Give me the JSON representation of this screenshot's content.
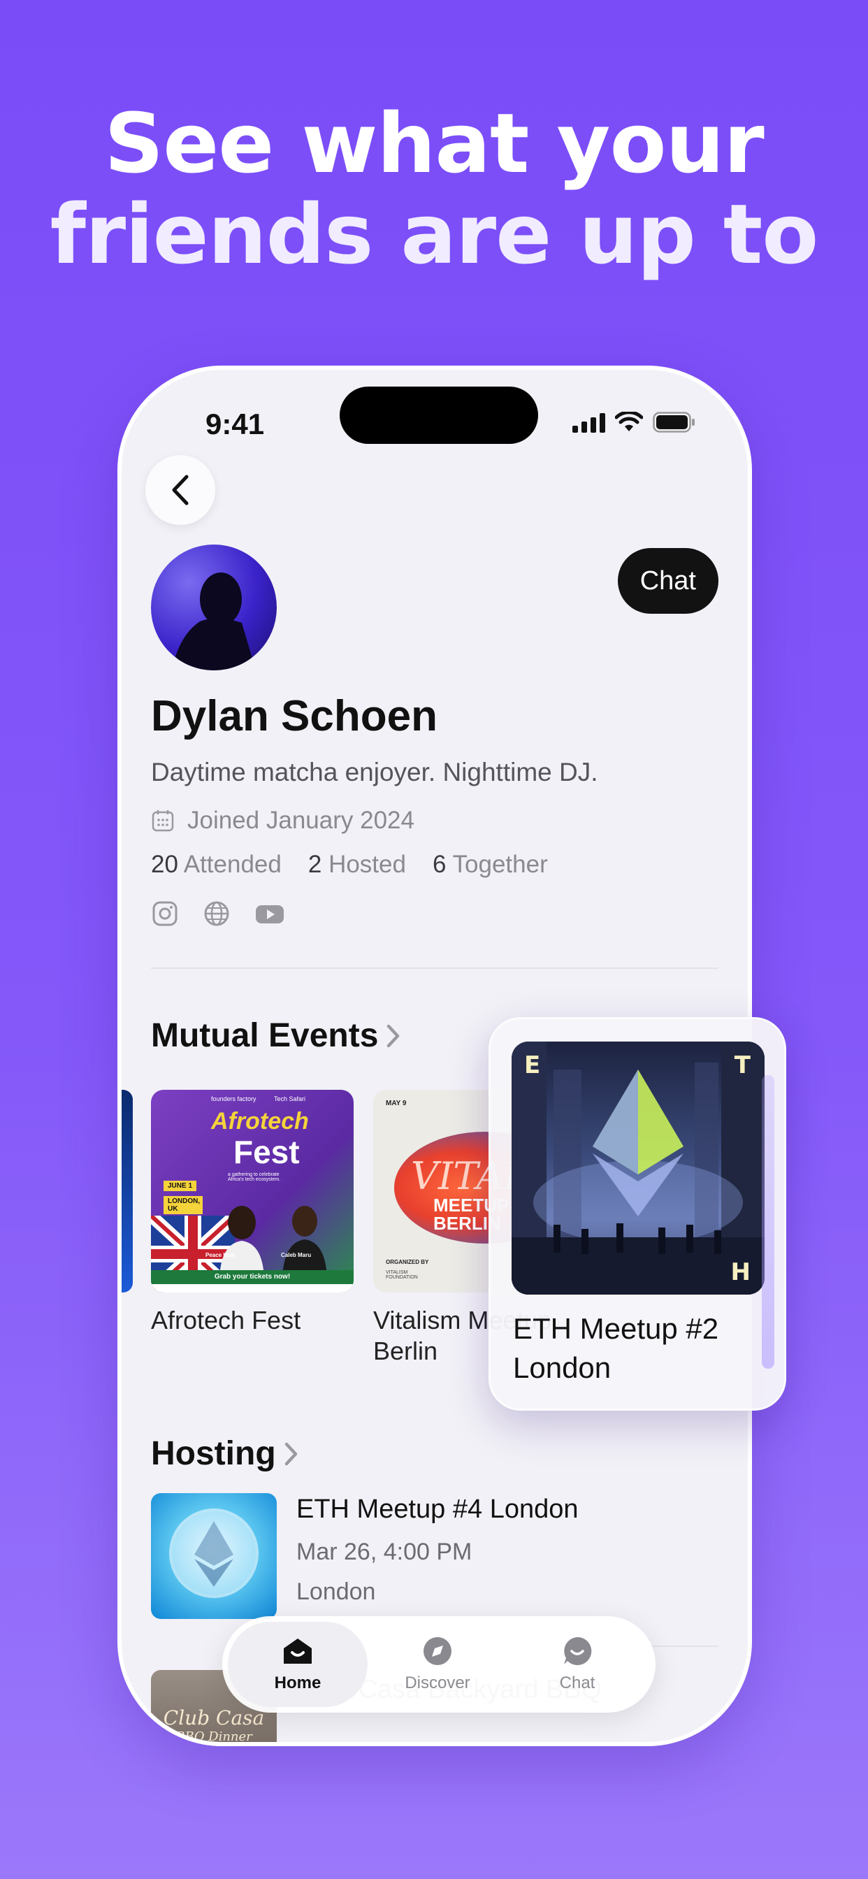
{
  "headline": {
    "line1": "See what your",
    "line2": "friends are up to"
  },
  "status_bar": {
    "time": "9:41"
  },
  "profile": {
    "chat_label": "Chat",
    "name": "Dylan Schoen",
    "bio": "Daytime matcha enjoyer. Nighttime DJ.",
    "joined": "Joined January 2024",
    "stats": [
      {
        "count": "20",
        "label": "Attended"
      },
      {
        "count": "2",
        "label": "Hosted"
      },
      {
        "count": "6",
        "label": "Together"
      }
    ],
    "socials": [
      "instagram-icon",
      "globe-icon",
      "youtube-icon"
    ]
  },
  "mutual_events": {
    "title": "Mutual Events",
    "items": [
      {
        "label": "Afrotech Fest",
        "poster": {
          "brand_left": "founders factory",
          "brand_right": "Tech Safari",
          "title_1": "Afrotech",
          "title_2": "Fest",
          "date": "JUNE 1",
          "place": "LONDON, UK",
          "tagline": "a gathering to celebrate Africa's tech ecosystem.",
          "person_1": "Peace Itimi",
          "person_2": "Caleb Maru",
          "cta": "Grab your tickets now!"
        }
      },
      {
        "label": "Vitalism Meetup Berlin",
        "poster": {
          "date": "MAY 9",
          "word": "VITALISM",
          "line_1": "MEETUP",
          "line_2": "BERLIN",
          "org_label": "ORGANIZED BY",
          "org_name": "VITALISM FOUNDATION"
        }
      }
    ]
  },
  "floating_card": {
    "title": "ETH Meetup #2 London",
    "letters": [
      "E",
      "T",
      "H"
    ]
  },
  "hosting": {
    "title": "Hosting",
    "items": [
      {
        "title": "ETH Meetup #4 London",
        "date": "Mar 26, 4:00 PM",
        "location": "London"
      },
      {
        "title": "Club Casa Backyard BBQ",
        "thumb_text_1": "Club Casa",
        "thumb_text_2": "BBQ Dinner"
      }
    ]
  },
  "tabs": [
    {
      "label": "Home",
      "active": true
    },
    {
      "label": "Discover",
      "active": false
    },
    {
      "label": "Chat",
      "active": false
    }
  ],
  "colors": {
    "background": "#7a4cf8",
    "accent": "#5b3cf0",
    "dark_button": "#121212"
  }
}
